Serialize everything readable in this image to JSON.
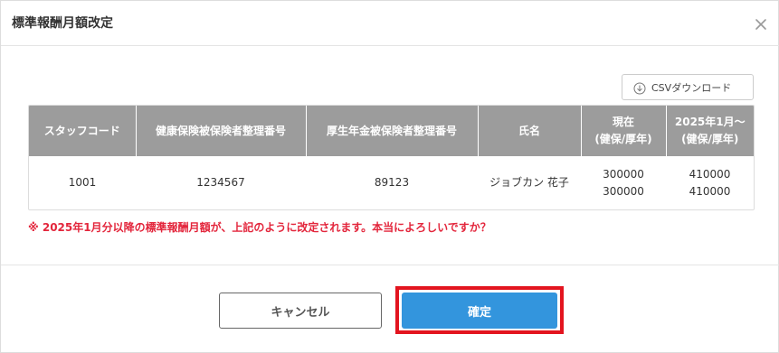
{
  "dialog": {
    "title": "標準報酬月額改定",
    "close_icon": "close-icon"
  },
  "toolbar": {
    "csv_download_label": "CSVダウンロード",
    "csv_icon": "download-icon"
  },
  "table": {
    "headers": [
      {
        "line1": "スタッフコード",
        "line2": ""
      },
      {
        "line1": "健康保険被保険者整理番号",
        "line2": ""
      },
      {
        "line1": "厚生年金被保険者整理番号",
        "line2": ""
      },
      {
        "line1": "氏名",
        "line2": ""
      },
      {
        "line1": "現在",
        "line2": "(健保/厚年)"
      },
      {
        "line1": "2025年1月〜",
        "line2": "(健保/厚年)"
      }
    ],
    "rows": [
      {
        "staff_code": "1001",
        "health_insurance_no": "1234567",
        "pension_no": "89123",
        "name": "ジョブカン 花子",
        "current_health": "300000",
        "current_pension": "300000",
        "new_health": "410000",
        "new_pension": "410000"
      }
    ]
  },
  "notice": "※ 2025年1月分以降の標準報酬月額が、上記のように改定されます。本当によろしいですか？",
  "footer": {
    "cancel_label": "キャンセル",
    "confirm_label": "確定"
  },
  "colors": {
    "header_bg": "#9c9c9c",
    "notice_text": "#e3263c",
    "confirm_bg": "#3395dd",
    "highlight_border": "#e3141f"
  }
}
